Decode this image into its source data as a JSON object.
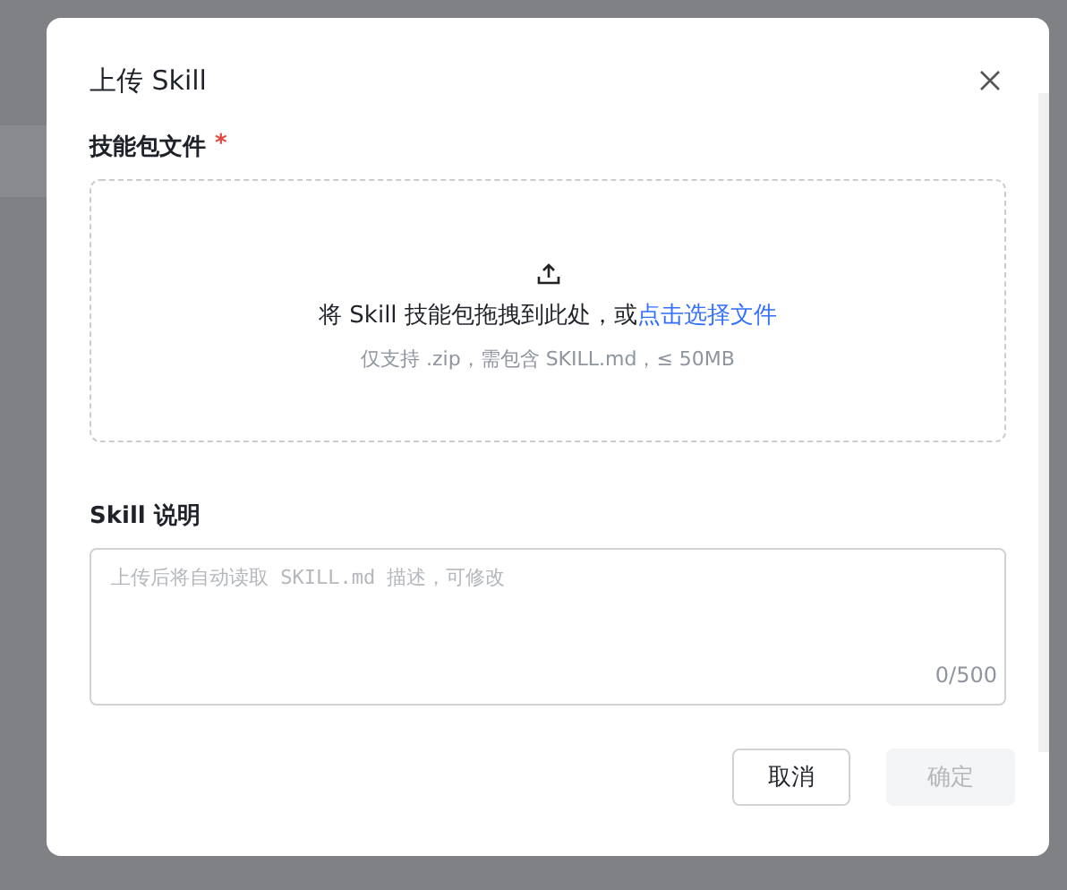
{
  "dialog": {
    "title": "上传 Skill",
    "file_field": {
      "label": "技能包文件",
      "required": true,
      "required_mark": "*",
      "prompt": "将 Skill 技能包拖拽到此处，或",
      "link": "点击选择文件",
      "hint": "仅支持 .zip，需包含 SKILL.md，≤ 50MB"
    },
    "description_field": {
      "label": "Skill 说明",
      "placeholder": "上传后将自动读取 SKILL.md 描述，可修改",
      "counter": "0/500"
    },
    "buttons": [
      {
        "label": "取消",
        "kind": "secondary",
        "disabled": false
      },
      {
        "label": "确定",
        "kind": "primary",
        "disabled": true
      }
    ]
  }
}
